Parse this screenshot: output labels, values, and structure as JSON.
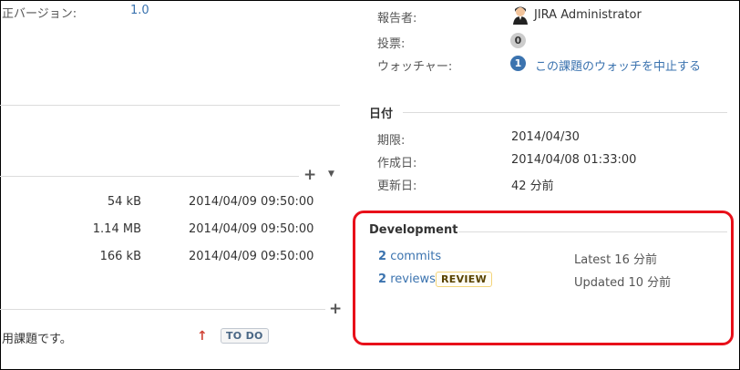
{
  "left": {
    "fix_version_label": "正バージョン:",
    "fix_version_value": "1.0",
    "attachments": [
      {
        "size": "54 kB",
        "date": "2014/04/09 09:50:00"
      },
      {
        "size": "1.14 MB",
        "date": "2014/04/09 09:50:00"
      },
      {
        "size": "166 kB",
        "date": "2014/04/09 09:50:00"
      }
    ],
    "subtask": {
      "summary": "用課題です。",
      "priority_icon": "arrow-up-icon",
      "status": "TO DO"
    }
  },
  "people": {
    "reporter_label": "報告者:",
    "reporter_name": "JIRA Administrator",
    "avatar_icon": "user-avatar-icon",
    "votes_label": "投票:",
    "votes_count": "0",
    "watchers_label": "ウォッチャー:",
    "watchers_count": "1",
    "watch_link": "この課題のウォッチを中止する"
  },
  "dates": {
    "title": "日付",
    "due_label": "期限:",
    "due_value": "2014/04/30",
    "created_label": "作成日:",
    "created_value": "2014/04/08 01:33:00",
    "updated_label": "更新日:",
    "updated_value": "42 分前"
  },
  "development": {
    "title": "Development",
    "commits_count": "2",
    "commits_label": "commits",
    "commits_latest": "Latest 16 分前",
    "reviews_count": "2",
    "reviews_label": "reviews",
    "review_lozenge": "REVIEW",
    "reviews_updated": "Updated 10 分前"
  },
  "colors": {
    "highlight_border": "#e8101a",
    "link": "#3b73af",
    "priority_arrow": "#d04437"
  }
}
